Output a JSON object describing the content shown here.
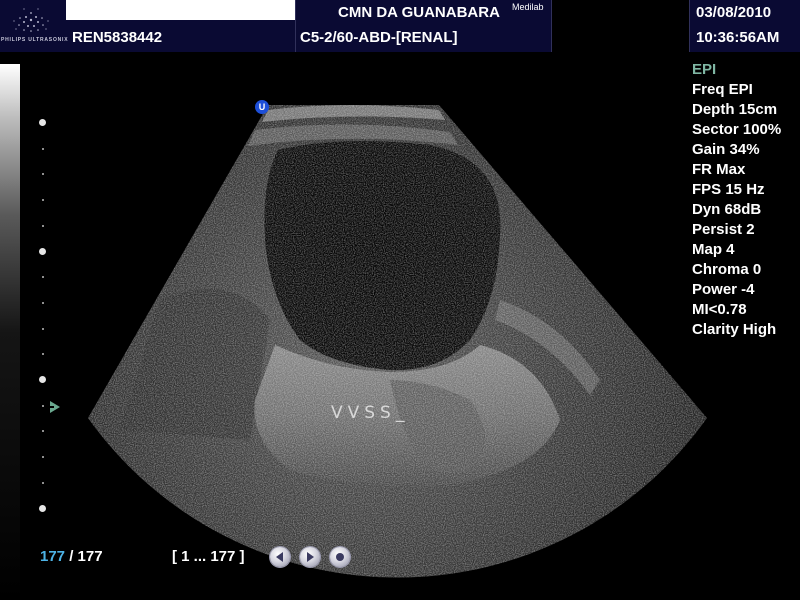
{
  "header": {
    "institution": "CMN DA GUANABARA",
    "institution_tag": "Medilab",
    "patient_id": "REN5838442",
    "probe_preset": "C5-2/60-ABD-[RENAL]",
    "date": "03/08/2010",
    "time": "10:36:56AM",
    "logo_text": "PHILIPS ULTRASONIX",
    "logo_icon": "ultrasonix-logo-icon"
  },
  "params": [
    "EPI",
    "Freq EPI",
    "Depth 15cm",
    "Sector 100%",
    "Gain 34%",
    "FR Max",
    "FPS 15 Hz",
    "Dyn 68dB",
    "Persist 2",
    "Map 4",
    "Chroma 0",
    "Power -4",
    "MI<0.78",
    "Clarity High"
  ],
  "active_param_color": "#7fb6a3",
  "image": {
    "orientation_marker": "U",
    "annotation": "VVSS_"
  },
  "footer": {
    "frame_current": "177",
    "frame_separator": "/",
    "frame_total": "177",
    "frame_range": "[ 1 ... 177 ]",
    "cine_buttons": [
      "rewind-icon",
      "play-icon",
      "stop-icon"
    ]
  },
  "colors": {
    "header_bg": "#0a0a33",
    "frame_current": "#4db3e6",
    "orientation_marker": "#1d4fd8"
  }
}
